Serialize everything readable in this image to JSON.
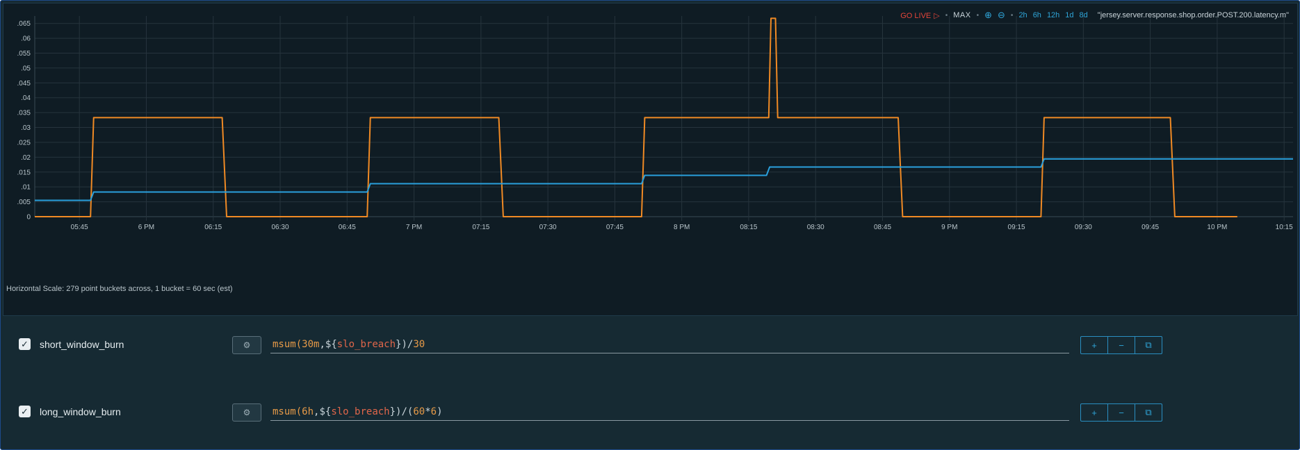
{
  "toolbar": {
    "go_live": "GO LIVE",
    "max": "MAX",
    "ranges": [
      "2h",
      "6h",
      "12h",
      "1d",
      "8d"
    ],
    "metric": "\"jersey.server.response.shop.order.POST.200.latency.m\""
  },
  "chart_data": {
    "type": "line",
    "y_ticks": [
      "0",
      ".005",
      ".01",
      ".015",
      ".02",
      ".025",
      ".03",
      ".035",
      ".04",
      ".045",
      ".05",
      ".055",
      ".06",
      ".065"
    ],
    "ylim": [
      0,
      0.0675
    ],
    "x_ticks": [
      "05:45",
      "6 PM",
      "06:15",
      "06:30",
      "06:45",
      "7 PM",
      "07:15",
      "07:30",
      "07:45",
      "8 PM",
      "08:15",
      "08:30",
      "08:45",
      "9 PM",
      "09:15",
      "09:30",
      "09:45",
      "10 PM",
      "10:15"
    ],
    "xlim_minutes": [
      335,
      617
    ],
    "grid": true,
    "series": [
      {
        "color": "#f08a24",
        "points": [
          [
            335,
            0
          ],
          [
            347.5,
            0
          ],
          [
            348.2,
            0.0333
          ],
          [
            377,
            0.0333
          ],
          [
            378,
            0
          ],
          [
            409.5,
            0
          ],
          [
            410.2,
            0.0333
          ],
          [
            439,
            0.0333
          ],
          [
            440,
            0
          ],
          [
            471,
            0
          ],
          [
            471.7,
            0.0333
          ],
          [
            499.5,
            0.0333
          ],
          [
            500,
            0.0667
          ],
          [
            501,
            0.0667
          ],
          [
            501.5,
            0.0333
          ],
          [
            528.5,
            0.0333
          ],
          [
            529.5,
            0
          ],
          [
            560.5,
            0
          ],
          [
            561.2,
            0.0333
          ],
          [
            589.5,
            0.0333
          ],
          [
            590.5,
            0
          ],
          [
            604.5,
            0
          ]
        ]
      },
      {
        "color": "#2aa0dc",
        "points": [
          [
            335,
            0.0055
          ],
          [
            347.5,
            0.0055
          ],
          [
            348.2,
            0.0083
          ],
          [
            409.5,
            0.0083
          ],
          [
            410.2,
            0.0111
          ],
          [
            471,
            0.0111
          ],
          [
            471.7,
            0.0139
          ],
          [
            499,
            0.0139
          ],
          [
            499.7,
            0.0167
          ],
          [
            560.5,
            0.0167
          ],
          [
            561.2,
            0.0194
          ],
          [
            617,
            0.0194
          ]
        ]
      }
    ]
  },
  "horizontal_scale": "Horizontal Scale: 279 point buckets across, 1 bucket = 60 sec (est)",
  "queries": [
    {
      "checked": true,
      "name": "short_window_burn",
      "expr_parts": [
        [
          "msum(",
          "kw"
        ],
        [
          "30m",
          "num"
        ],
        [
          ", ",
          "punct"
        ],
        [
          "${",
          "punct"
        ],
        [
          "slo_breach",
          "var"
        ],
        [
          "}",
          "punct"
        ],
        [
          ")/",
          "punct"
        ],
        [
          "30",
          "num"
        ]
      ]
    },
    {
      "checked": true,
      "name": "long_window_burn",
      "expr_parts": [
        [
          "msum(",
          "kw"
        ],
        [
          "6h",
          "num"
        ],
        [
          ", ",
          "punct"
        ],
        [
          "${",
          "punct"
        ],
        [
          "slo_breach",
          "var"
        ],
        [
          "}",
          "punct"
        ],
        [
          ")/",
          "punct"
        ],
        [
          "(",
          "punct"
        ],
        [
          "60",
          "num"
        ],
        [
          "*",
          "punct"
        ],
        [
          "6",
          "num"
        ],
        [
          ")",
          "punct"
        ]
      ]
    }
  ],
  "row_buttons": {
    "plus": "+",
    "minus": "−",
    "copy": "⧉"
  },
  "colors": {
    "accent": "#2fa5d8",
    "live": "#e5453a",
    "series_orange": "#f08a24",
    "series_blue": "#2aa0dc"
  }
}
